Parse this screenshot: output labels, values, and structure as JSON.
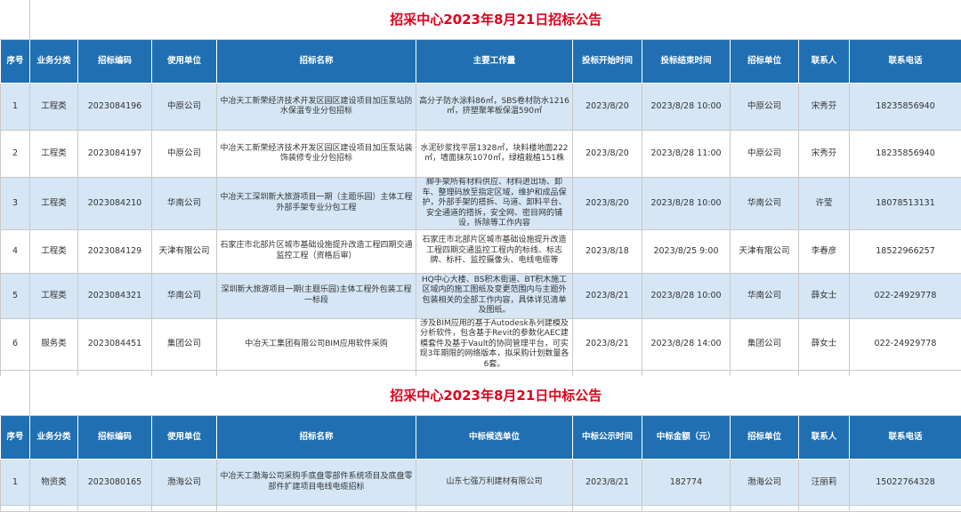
{
  "tender": {
    "title": "招采中心2023年8月21日招标公告",
    "headers": [
      "序号",
      "业务分类",
      "招标编码",
      "使用单位",
      "招标名称",
      "主要工作量",
      "投标开始时间",
      "投标结束时间",
      "招标单位",
      "联系人",
      "联系电话"
    ],
    "rows": [
      [
        "1",
        "工程类",
        "2023084196",
        "中原公司",
        "中冶天工新荣经济技术开发区园区建设项目加压泵站防水保温专业分包招标",
        "高分子防水涂料86㎡，SBS卷材防水1216㎡，挤塑聚苯板保温590㎡",
        "2023/8/20",
        "2023/8/28 10:00",
        "中原公司",
        "宋秀芬",
        "18235856940"
      ],
      [
        "2",
        "工程类",
        "2023084197",
        "中原公司",
        "中冶天工新荣经济技术开发区园区建设项目加压泵站装饰装修专业分包招标",
        "水泥砂浆找平层1328㎡，块料楼地面222㎡，墙面抹灰1070㎡，绿植栽植151株",
        "2023/8/20",
        "2023/8/28 11:00",
        "中原公司",
        "宋秀芬",
        "18235856940"
      ],
      [
        "3",
        "工程类",
        "2023084210",
        "华南公司",
        "中冶天工深圳新大旅游项目一期（主题乐园）主体工程外部手架专业分包工程",
        "脚手架所有材料供应、材料进出场、卸车、整理码放至指定区域，维护和成品保护，外部手架的搭拆、马道、卸料平台、安全通道的搭拆，安全网、密目网的铺设，拆除等工作内容",
        "2023/8/20",
        "2023/8/28 10:00",
        "华南公司",
        "许莹",
        "18078513131"
      ],
      [
        "4",
        "工程类",
        "2023084129",
        "天津有限公司",
        "石家庄市北部片区城市基础设施提升改造工程四期交通监控工程（资格后审）",
        "石家庄市北部片区城市基础设施提升改造工程四期交通监控工程内的标线、标志牌、标杆、监控摄像头、电线电缆等",
        "2023/8/18",
        "2023/8/25 9:00",
        "天津有限公司",
        "李春彦",
        "18522966257"
      ],
      [
        "5",
        "工程类",
        "2023084321",
        "华南公司",
        "深圳新大旅游项目一期(主题乐园)主体工程外包装工程一标段",
        "HQ中心大楼、BS积木街道、BT积木施工区域内的施工图纸及变更范围内与主题外包装相关的全部工作内容，具体详见清单及图纸。",
        "2023/8/21",
        "2023/8/28 10:00",
        "华南公司",
        "薛女士",
        "022-24929778"
      ],
      [
        "6",
        "服务类",
        "2023084451",
        "集团公司",
        "中冶天工集团有限公司BIM应用软件采购",
        "涉及BIM应用的基于Autodesk系列建模及分析软件，包含基于Revit的参数化AEC建模套件及基于Vault的协同管理平台，可实现3年期限的网络版本，拟采购计划数量各6套。",
        "2023/8/21",
        "2023/8/28 14:00",
        "集团公司",
        "薛女士",
        "022-24929778"
      ]
    ]
  },
  "award": {
    "title": "招采中心2023年8月21日中标公告",
    "headers": [
      "序号",
      "业务分类",
      "招标编码",
      "使用单位",
      "招标名称",
      "中标候选单位",
      "中标公示时间",
      "中标金额（元）",
      "招标单位",
      "联系人",
      "联系电话"
    ],
    "rows": [
      [
        "1",
        "物资类",
        "2023080165",
        "渤海公司",
        "中冶天工渤海公司采购手底盘零部件系统项目及底盘零部件扩建项目电线电缆招标",
        "山东七强万利建材有限公司",
        "2023/8/21",
        "182774",
        "渤海公司",
        "汪丽莉",
        "15022764328"
      ]
    ]
  }
}
